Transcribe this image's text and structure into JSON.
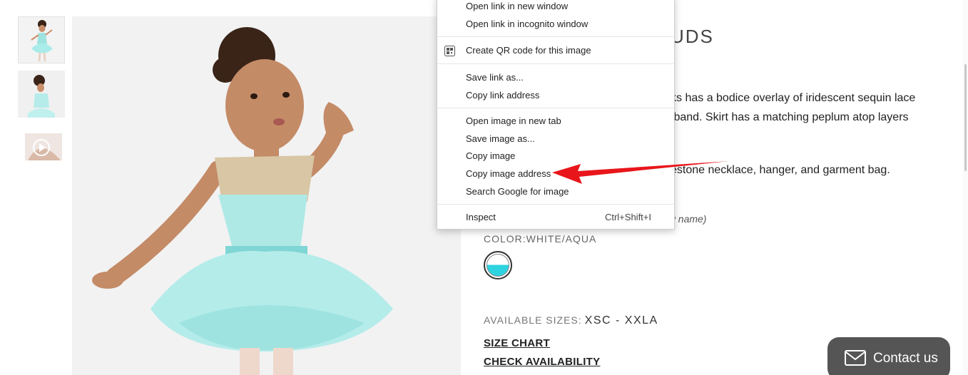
{
  "product": {
    "title_partial": "UDS",
    "description_line1": "ks has a bodice overlay of iridescent sequin lace",
    "description_line2": "tband. Skirt has a matching peplum atop layers",
    "description_line3": "estone necklace, hanger, and garment bag.",
    "name_note": "ew name)",
    "color_label": "COLOR:WHITE/AQUA",
    "swatch_colors": {
      "top": "#ffffff",
      "bottom": "#2ed3e0"
    },
    "sizes_label": "AVAILABLE SIZES:",
    "sizes_value": "XSC - XXLA",
    "size_chart_link": "SIZE CHART",
    "check_availability_link": "CHECK AVAILABILITY"
  },
  "thumbnails": [
    {
      "name": "thumbnail-front"
    },
    {
      "name": "thumbnail-back"
    },
    {
      "name": "thumbnail-video",
      "icon": "play-icon"
    }
  ],
  "context_menu": {
    "items": [
      {
        "label": "Open link in new window"
      },
      {
        "label": "Open link in incognito window"
      },
      {
        "label": "Create QR code for this image",
        "icon": "qr-code-icon"
      },
      {
        "label": "Save link as..."
      },
      {
        "label": "Copy link address"
      },
      {
        "label": "Open image in new tab"
      },
      {
        "label": "Save image as..."
      },
      {
        "label": "Copy image"
      },
      {
        "label": "Copy image address"
      },
      {
        "label": "Search Google for image"
      },
      {
        "label": "Inspect",
        "shortcut": "Ctrl+Shift+I"
      }
    ]
  },
  "contact": {
    "label": "Contact us",
    "icon": "mail-icon",
    "color": "#555555"
  },
  "annotation": {
    "arrow_color": "#e8161b"
  }
}
